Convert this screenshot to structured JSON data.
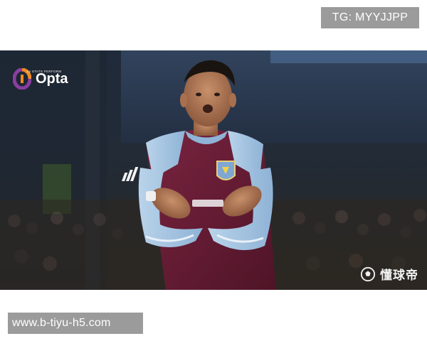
{
  "overlay": {
    "top_badge": "TG: MYYJJPP",
    "bottom_badge": "www.b-tiyu-h5.com"
  },
  "photo": {
    "logo_text": "Opta",
    "logo_subtext": "by STATS PERFORM",
    "watermark_text": "懂球帝"
  },
  "colors": {
    "badge_bg": "#9b9b9b",
    "kit_claret": "#6e1f36",
    "kit_sky_blue": "#9fc4e4",
    "stadium_dark": "#1a2230",
    "opta_orange": "#f08a24",
    "opta_purple": "#8a3ea0"
  },
  "icons": [
    "opta-logo-icon",
    "football-icon"
  ]
}
